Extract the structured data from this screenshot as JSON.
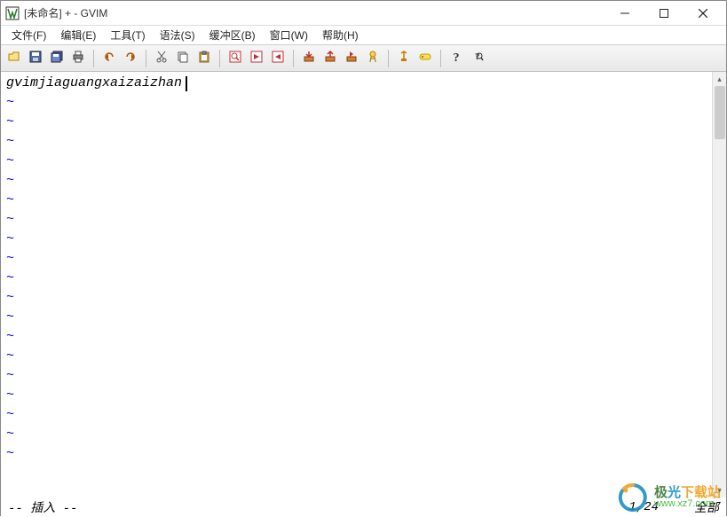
{
  "titlebar": {
    "title": "[未命名] + - GVIM"
  },
  "menubar": {
    "items": [
      "文件(F)",
      "编辑(E)",
      "工具(T)",
      "语法(S)",
      "缓冲区(B)",
      "窗口(W)",
      "帮助(H)"
    ]
  },
  "toolbar": {
    "groups": [
      [
        "open",
        "save",
        "saveall",
        "print"
      ],
      [
        "undo",
        "redo"
      ],
      [
        "cut",
        "copy",
        "paste"
      ],
      [
        "find",
        "findnext",
        "findprev"
      ],
      [
        "loadsession",
        "savesession",
        "runscript",
        "makectags"
      ],
      [
        "tagjump",
        "tagback"
      ],
      [
        "help",
        "searchhelp"
      ]
    ],
    "icons": {
      "open": "open-icon",
      "save": "save-icon",
      "saveall": "saveall-icon",
      "print": "print-icon",
      "undo": "undo-icon",
      "redo": "redo-icon",
      "cut": "cut-icon",
      "copy": "copy-icon",
      "paste": "paste-icon",
      "find": "find-icon",
      "findnext": "findnext-icon",
      "findprev": "findprev-icon",
      "loadsession": "loadsession-icon",
      "savesession": "savesession-icon",
      "runscript": "runscript-icon",
      "makectags": "makectags-icon",
      "tagjump": "tagjump-icon",
      "tagback": "tagback-icon",
      "help": "help-icon",
      "searchhelp": "searchhelp-icon"
    }
  },
  "editor": {
    "content": "gvimjiaguangxaizaizhan",
    "tilde": "~",
    "tilde_rows": 19
  },
  "statusbar": {
    "mode": "-- 插入 --",
    "position": "1,24",
    "scroll": "全部"
  },
  "watermark": {
    "line1_a": "极",
    "line1_b": "光",
    "line1_c": "下载站",
    "line2": "www.xz7.com"
  }
}
